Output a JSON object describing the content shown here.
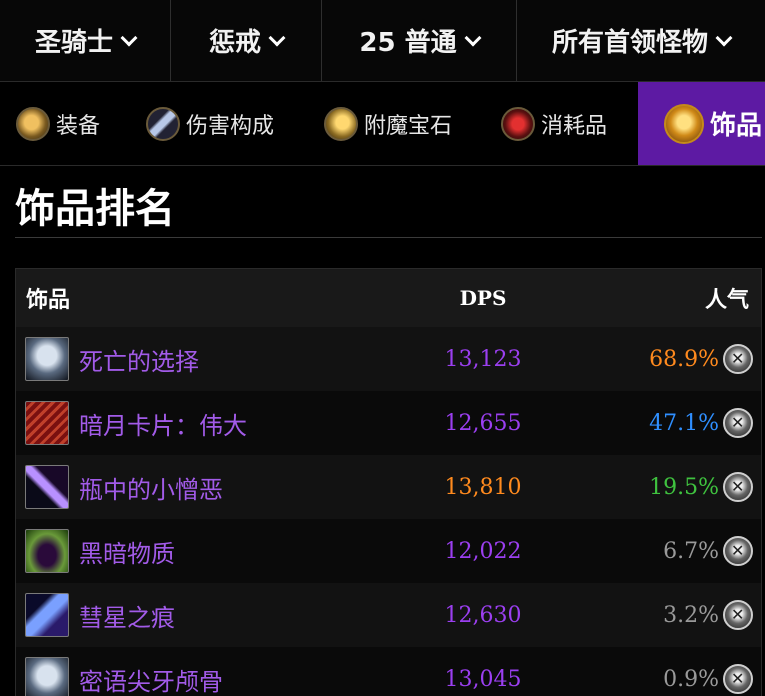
{
  "filters": [
    {
      "label": "圣骑士"
    },
    {
      "label": "惩戒"
    },
    {
      "label": "25 普通"
    },
    {
      "label": "所有首领怪物"
    }
  ],
  "tabs": [
    {
      "label": "装备",
      "icon": "armor-icon"
    },
    {
      "label": "伤害构成",
      "icon": "sword-icon"
    },
    {
      "label": "附魔宝石",
      "icon": "gem-icon"
    },
    {
      "label": "消耗品",
      "icon": "potion-icon"
    },
    {
      "label": "饰品",
      "icon": "trinket-icon",
      "active": true
    }
  ],
  "section": {
    "title": "饰品排名"
  },
  "table": {
    "headers": {
      "name": "饰品",
      "dps": "DPS",
      "popularity": "人气"
    },
    "rows": [
      {
        "name": "死亡的选择",
        "dps": "13,123",
        "popularity": "68.9%",
        "icon": "skull-icon"
      },
      {
        "name": "暗月卡片：伟大",
        "dps": "12,655",
        "popularity": "47.1%",
        "icon": "card-icon"
      },
      {
        "name": "瓶中的小憎恶",
        "dps": "13,810",
        "popularity": "19.5%",
        "icon": "bottle-icon"
      },
      {
        "name": "黑暗物质",
        "dps": "12,022",
        "popularity": "6.7%",
        "icon": "orb-icon"
      },
      {
        "name": "彗星之痕",
        "dps": "12,630",
        "popularity": "3.2%",
        "icon": "comet-icon"
      },
      {
        "name": "密语尖牙颅骨",
        "dps": "13,045",
        "popularity": "0.9%",
        "icon": "skull-icon"
      }
    ]
  },
  "colors": {
    "active_tab": "#5d1aa3",
    "item_name": "#a25be8",
    "dps": "#9b3ff0",
    "dps_best": "#ff8a1e",
    "pop_orange": "#ff8a1e",
    "pop_blue": "#2f8fff",
    "pop_green": "#3fc23f",
    "pop_grey": "#9a9a9a"
  }
}
